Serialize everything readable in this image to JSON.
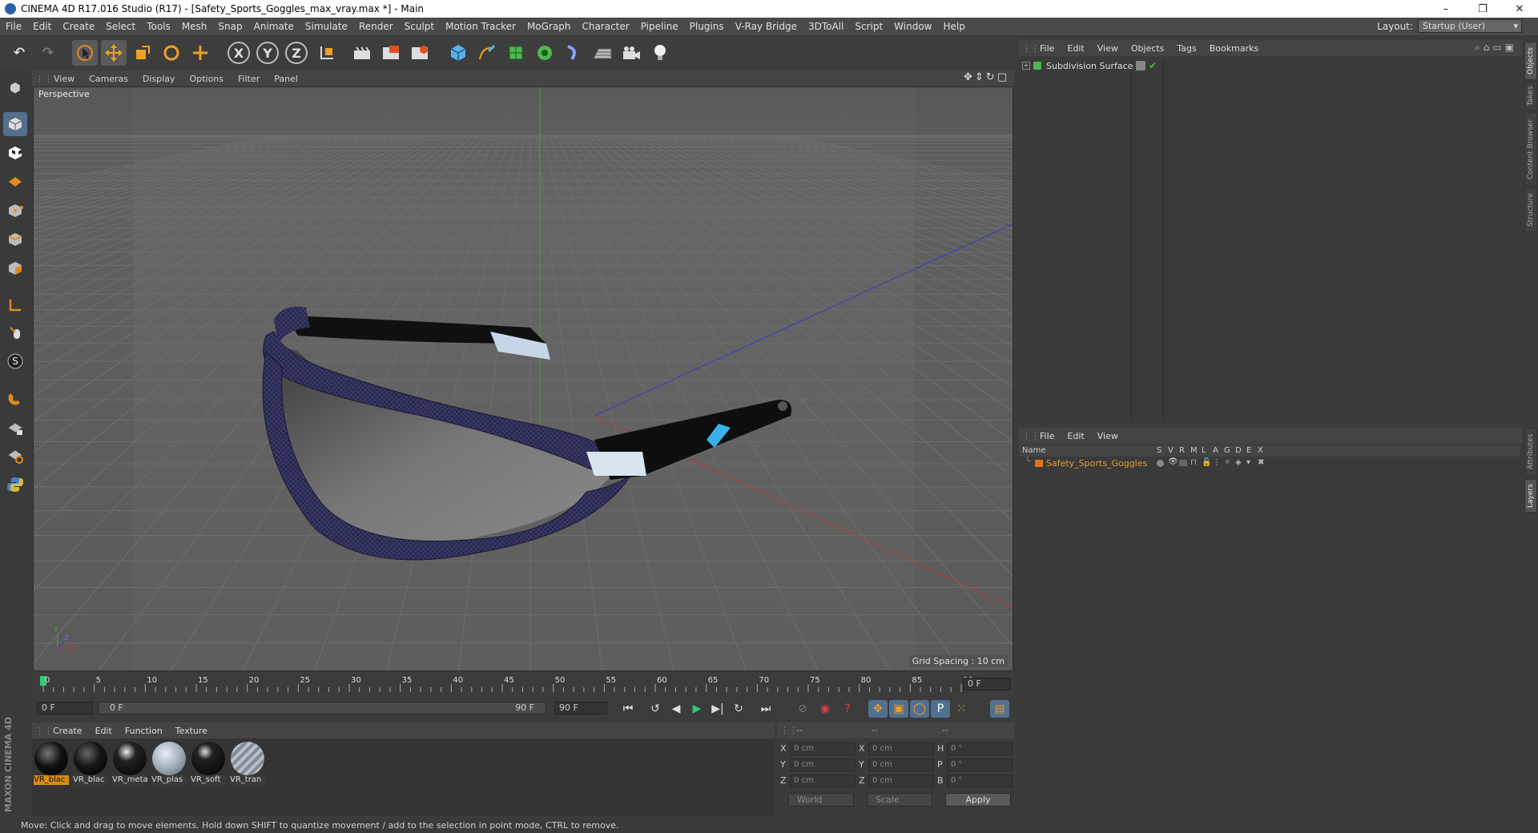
{
  "window": {
    "title": "CINEMA 4D R17.016 Studio (R17) - [Safety_Sports_Goggles_max_vray.max *] - Main",
    "min_glyph": "–",
    "max_glyph": "❐",
    "close_glyph": "✕"
  },
  "menu": [
    "File",
    "Edit",
    "Create",
    "Select",
    "Tools",
    "Mesh",
    "Snap",
    "Animate",
    "Simulate",
    "Render",
    "Sculpt",
    "Motion Tracker",
    "MoGraph",
    "Character",
    "Pipeline",
    "Plugins",
    "V-Ray Bridge",
    "3DToAll",
    "Script",
    "Window",
    "Help"
  ],
  "layout": {
    "label": "Layout:",
    "value": "Startup (User)"
  },
  "toolbar": {
    "x_label": "X",
    "y_label": "Y",
    "z_label": "Z"
  },
  "viewport": {
    "menu": [
      "View",
      "Cameras",
      "Display",
      "Options",
      "Filter",
      "Panel"
    ],
    "camera_label": "Perspective",
    "grid_spacing": "Grid Spacing : 10 cm",
    "axis_y": "Y",
    "axis_x": "X",
    "axis_z": "Z"
  },
  "timeline": {
    "ticks": [
      "0",
      "5",
      "10",
      "15",
      "20",
      "25",
      "30",
      "35",
      "40",
      "45",
      "50",
      "55",
      "60",
      "65",
      "70",
      "75",
      "80",
      "85",
      "90"
    ],
    "current_frame": "0 F"
  },
  "time_controls": {
    "start": "0 F",
    "range_start": "0 F",
    "range_end": "90 F",
    "end": "90 F"
  },
  "materials": {
    "menu": [
      "Create",
      "Edit",
      "Function",
      "Texture"
    ],
    "items": [
      {
        "name": "VR_blac",
        "selected": true
      },
      {
        "name": "VR_blac",
        "selected": false
      },
      {
        "name": "VR_meta",
        "selected": false
      },
      {
        "name": "VR_plas",
        "selected": false
      },
      {
        "name": "VR_soft",
        "selected": false
      },
      {
        "name": "VR_tran",
        "selected": false
      }
    ],
    "brand": "MAXON CINEMA 4D"
  },
  "coords": {
    "header": [
      "--",
      "--",
      "--"
    ],
    "rows": [
      {
        "a": "X",
        "av": "0 cm",
        "b": "X",
        "bv": "0 cm",
        "c": "H",
        "cv": "0 °"
      },
      {
        "a": "Y",
        "av": "0 cm",
        "b": "Y",
        "bv": "0 cm",
        "c": "P",
        "cv": "0 °"
      },
      {
        "a": "Z",
        "av": "0 cm",
        "b": "Z",
        "bv": "0 cm",
        "c": "B",
        "cv": "0 °"
      }
    ],
    "world": "World",
    "scale": "Scale",
    "apply": "Apply"
  },
  "status": "Move: Click and drag to move elements. Hold down SHIFT to quantize movement / add to the selection in point mode, CTRL to remove.",
  "objects": {
    "menu": [
      "File",
      "Edit",
      "View",
      "Objects",
      "Tags",
      "Bookmarks"
    ],
    "items": [
      {
        "name": "Subdivision Surface"
      }
    ]
  },
  "layers": {
    "menu": [
      "File",
      "Edit",
      "View"
    ],
    "name_col": "Name",
    "flag_cols": [
      "S",
      "V",
      "R",
      "M",
      "L",
      "A",
      "G",
      "D",
      "E",
      "X"
    ],
    "items": [
      {
        "name": "Safety_Sports_Goggles",
        "color": "#e0741c"
      }
    ]
  },
  "side_tabs": [
    "Objects",
    "Takes",
    "Content Browser",
    "Structure",
    "Attributes",
    "Layers"
  ],
  "colors": {
    "accent": "#d88a17",
    "selection_blue": "#52708f",
    "object_green": "#5fb35f"
  }
}
